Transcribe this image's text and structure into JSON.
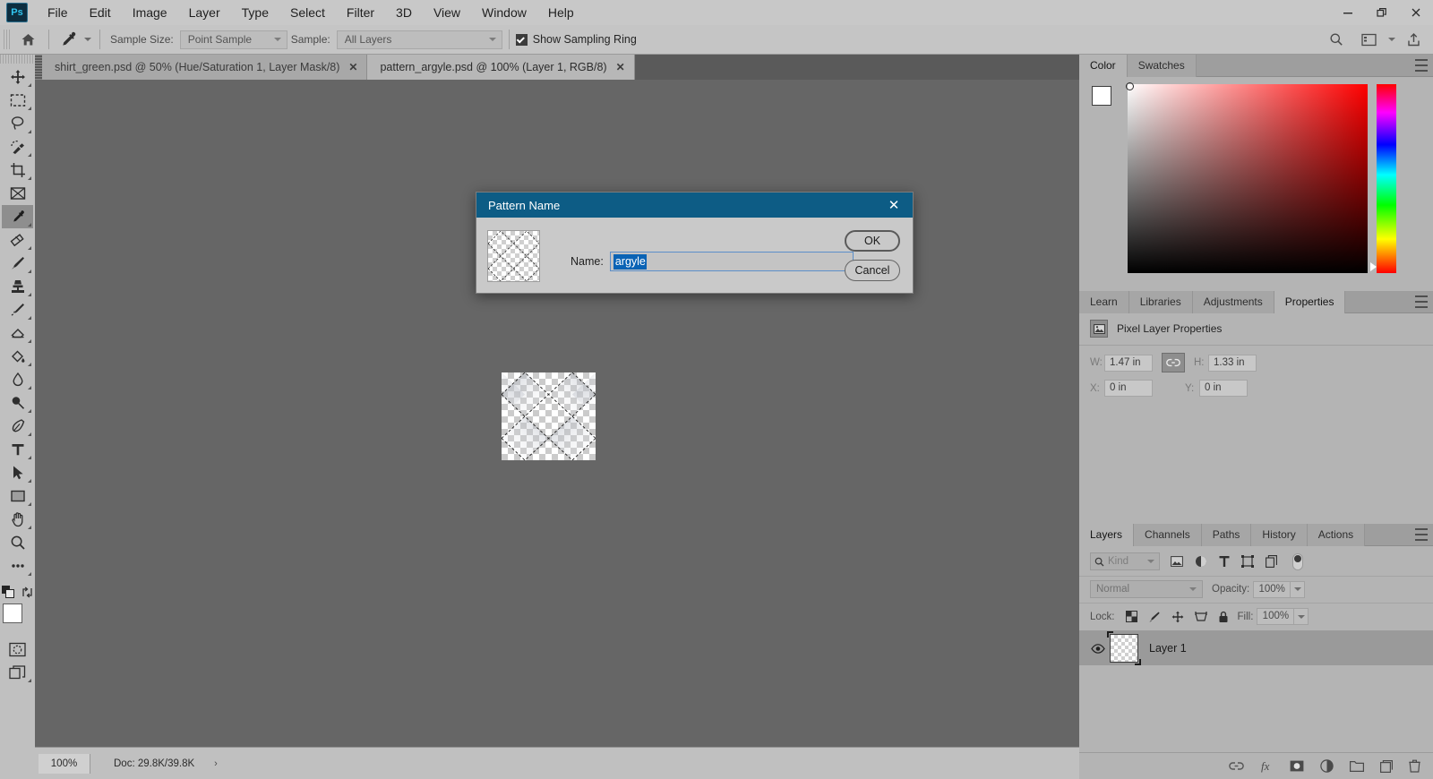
{
  "app": {
    "logo": "Ps",
    "window_controls": {
      "minimize": "—",
      "maximize": "❐",
      "close": "✕"
    }
  },
  "menubar": {
    "items": [
      {
        "label": "File"
      },
      {
        "label": "Edit"
      },
      {
        "label": "Image"
      },
      {
        "label": "Layer"
      },
      {
        "label": "Type"
      },
      {
        "label": "Select"
      },
      {
        "label": "Filter"
      },
      {
        "label": "3D"
      },
      {
        "label": "View"
      },
      {
        "label": "Window"
      },
      {
        "label": "Help"
      }
    ]
  },
  "options_bar": {
    "home_icon": "home-icon",
    "tool_icon": "eyedropper-icon",
    "sample_size_label": "Sample Size:",
    "sample_size_value": "Point Sample",
    "sample_label": "Sample:",
    "sample_value": "All Layers",
    "show_sampling_ring_label": "Show Sampling Ring",
    "show_sampling_ring_checked": true,
    "search_icon": "search-icon",
    "workspace_icon": "workspace-icon",
    "share_icon": "share-icon"
  },
  "toolbar": {
    "tools": [
      {
        "name": "move-tool",
        "icon": "move",
        "active": false
      },
      {
        "name": "marquee-tool",
        "icon": "marquee",
        "active": false
      },
      {
        "name": "lasso-tool",
        "icon": "lasso",
        "active": false
      },
      {
        "name": "quick-selection-tool",
        "icon": "quickselect",
        "active": false
      },
      {
        "name": "crop-tool",
        "icon": "crop",
        "active": false
      },
      {
        "name": "frame-tool",
        "icon": "frame",
        "active": false
      },
      {
        "name": "eyedropper-tool",
        "icon": "eyedropper",
        "active": true
      },
      {
        "name": "healing-brush-tool",
        "icon": "heal",
        "active": false
      },
      {
        "name": "brush-tool",
        "icon": "brush",
        "active": false
      },
      {
        "name": "clone-stamp-tool",
        "icon": "stamp",
        "active": false
      },
      {
        "name": "history-brush-tool",
        "icon": "historybrush",
        "active": false
      },
      {
        "name": "eraser-tool",
        "icon": "eraser",
        "active": false
      },
      {
        "name": "gradient-tool",
        "icon": "paintbucket",
        "active": false
      },
      {
        "name": "blur-tool",
        "icon": "blur",
        "active": false
      },
      {
        "name": "dodge-tool",
        "icon": "dodge",
        "active": false
      },
      {
        "name": "pen-tool",
        "icon": "pen",
        "active": false
      },
      {
        "name": "type-tool",
        "icon": "type",
        "active": false
      },
      {
        "name": "path-selection-tool",
        "icon": "pathselect",
        "active": false
      },
      {
        "name": "rectangle-tool",
        "icon": "rectangle",
        "active": false
      },
      {
        "name": "hand-tool",
        "icon": "hand",
        "active": false
      },
      {
        "name": "zoom-tool",
        "icon": "zoom",
        "active": false
      },
      {
        "name": "edit-toolbar",
        "icon": "ellipsis",
        "active": false
      }
    ],
    "foreground_color": "#ffffff",
    "background_color": "#ffffff",
    "quickmask_icon": "quickmask-icon",
    "screenmode_icon": "screenmode-icon",
    "swap_icon": "swap-colors-icon",
    "default_colors_icon": "default-colors-icon"
  },
  "document_tabs": [
    {
      "label": "shirt_green.psd @ 50% (Hue/Saturation 1, Layer Mask/8)",
      "active": false,
      "close": "✕"
    },
    {
      "label": "pattern_argyle.psd @ 100% (Layer 1, RGB/8)",
      "active": true,
      "close": "✕"
    }
  ],
  "status_bar": {
    "zoom": "100%",
    "doc_info": "Doc: 29.8K/39.8K",
    "caret": "›"
  },
  "dialog": {
    "title": "Pattern Name",
    "close": "✕",
    "name_label": "Name:",
    "name_value": "argyle",
    "name_selected": true,
    "ok_label": "OK",
    "cancel_label": "Cancel",
    "thumbnail_name": "pattern-preview-thumbnail"
  },
  "color_panel": {
    "tabs": [
      {
        "label": "Color",
        "active": true
      },
      {
        "label": "Swatches",
        "active": false
      }
    ],
    "foreground_color": "#ffffff",
    "background_color": "#ffffff",
    "field_base_hue": "#ff0000"
  },
  "properties_panel": {
    "tabs": [
      {
        "label": "Learn",
        "active": false
      },
      {
        "label": "Libraries",
        "active": false
      },
      {
        "label": "Adjustments",
        "active": false
      },
      {
        "label": "Properties",
        "active": true
      }
    ],
    "header": "Pixel Layer Properties",
    "fields": {
      "w_label": "W:",
      "w_value": "1.47 in",
      "h_label": "H:",
      "h_value": "1.33 in",
      "x_label": "X:",
      "x_value": "0 in",
      "y_label": "Y:",
      "y_value": "0 in",
      "link_icon": "link-icon"
    }
  },
  "layers_panel": {
    "tabs": [
      {
        "label": "Layers",
        "active": true
      },
      {
        "label": "Channels",
        "active": false
      },
      {
        "label": "Paths",
        "active": false
      },
      {
        "label": "History",
        "active": false
      },
      {
        "label": "Actions",
        "active": false
      }
    ],
    "filter_kind": "Kind",
    "blend_mode": "Normal",
    "opacity_label": "Opacity:",
    "opacity_value": "100%",
    "lock_label": "Lock:",
    "fill_label": "Fill:",
    "fill_value": "100%",
    "layers": [
      {
        "name": "Layer 1",
        "visible": true,
        "selected": true
      }
    ],
    "footer_icons": [
      "link-layers-icon",
      "layer-style-fx-icon",
      "add-mask-icon",
      "adjustment-layer-icon",
      "new-group-icon",
      "new-layer-icon",
      "delete-layer-icon"
    ]
  }
}
